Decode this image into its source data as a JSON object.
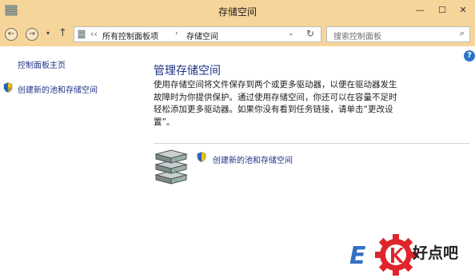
{
  "window": {
    "title": "存储空间",
    "minimize": "—",
    "maximize": "☐",
    "close": "✕"
  },
  "nav": {
    "back": "←",
    "forward": "→",
    "recent": "▾",
    "up": "↑",
    "breadcrumb": [
      "所有控制面板项",
      "存储空间"
    ],
    "breadcrumb_sep": "‹‹",
    "crumb_arrow": "›",
    "dropdown": "⌄",
    "refresh": "↻",
    "search_placeholder": "搜索控制面板",
    "search_icon": "⌕"
  },
  "help": "?",
  "sidebar": {
    "home": "控制面板主页",
    "create": "创建新的池和存储空间"
  },
  "main": {
    "heading": "管理存储空间",
    "description": "使用存储空间将文件保存到两个或更多驱动器，以便在驱动器发生故障时为你提供保护。通过使用存储空间，你还可以在容量不足时轻松添加更多驱动器。如果你没有看到任务链接，请单击“更改设置”。",
    "create_link": "创建新的池和存储空间"
  },
  "watermark": {
    "text": "好点吧"
  },
  "colors": {
    "titlebar": "#f6d59a",
    "link": "#1e3287",
    "help": "#2a74c8",
    "watermark_red": "#e0242b"
  }
}
